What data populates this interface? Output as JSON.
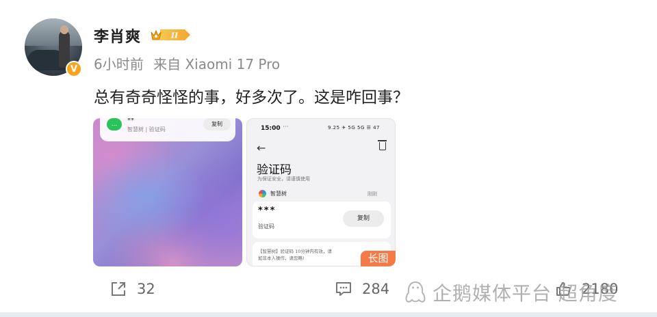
{
  "post": {
    "author": "李肖爽",
    "level_badge": "II",
    "time": "6小时前",
    "source": "来自 Xiaomi 17 Pro",
    "text": "总有奇奇怪怪的事，好多次了。这是咋回事？"
  },
  "image1": {
    "notification": {
      "app_icon": "...",
      "title": "**",
      "source": "智慧树 | 验证码",
      "copy_label": "复制"
    }
  },
  "image2": {
    "status_time": "15:00",
    "status_dots": "···",
    "status_icons": "9.25 ✈ 5G 5G ☰ 47",
    "title": "验证码",
    "subtitle": "为保证安全，请谨慎使用",
    "sender": "智慧树",
    "received_time": "刚刚",
    "code": "*** ",
    "code_label": "验证码",
    "copy_label": "复制",
    "message_line1": "【智慧树】验证码        10分钟内有效，请",
    "message_line2": "如非本人操作，请忽略!",
    "long_image_badge": "长图"
  },
  "actions": {
    "share_count": "32",
    "comment_count": "284",
    "like_count": "2180"
  },
  "watermark": {
    "text": "企鹅媒体平台 超角度"
  },
  "colors": {
    "badge_orange": "#f7a51c",
    "long_badge": "#f47a47",
    "text_main": "#222222",
    "text_meta": "#8a8a8a"
  }
}
